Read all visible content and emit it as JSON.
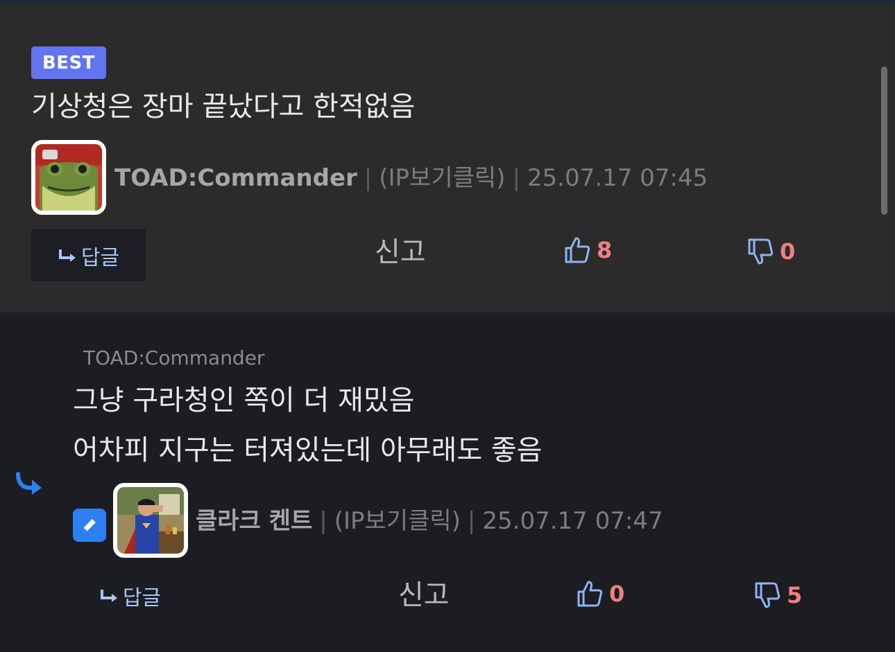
{
  "best_comment": {
    "badge": "BEST",
    "text": "기상청은 장마 끝났다고 한적없음",
    "author": {
      "nickname": "TOAD:Commander",
      "ip_label": "(IP보기클릭)",
      "timestamp": "25.07.17 07:45",
      "separator": "|"
    },
    "actions": {
      "reply_label": "답글",
      "report_label": "신고",
      "upvotes": "8",
      "downvotes": "0"
    }
  },
  "reply_comment": {
    "quoted_nickname": "TOAD:Commander",
    "text_lines": [
      "그냥 구라청인 쪽이 더 재밌음",
      "어차피 지구는 터져있는데 아무래도 좋음"
    ],
    "author": {
      "nickname": "클라크 켄트",
      "ip_label": "(IP보기클릭)",
      "timestamp": "25.07.17 07:47",
      "separator": "|"
    },
    "actions": {
      "reply_label": "답글",
      "report_label": "신고",
      "upvotes": "0",
      "downvotes": "5"
    }
  },
  "icons": {
    "reply": "reply-arrow-icon",
    "upvote": "thumbs-up-icon",
    "downvote": "thumbs-down-icon",
    "edit": "pencil-icon"
  },
  "colors": {
    "best_badge": "#6374f0",
    "vote_count": "#f08080",
    "vote_icon": "#8fb4f2",
    "edit_badge": "#2d7ff3"
  }
}
